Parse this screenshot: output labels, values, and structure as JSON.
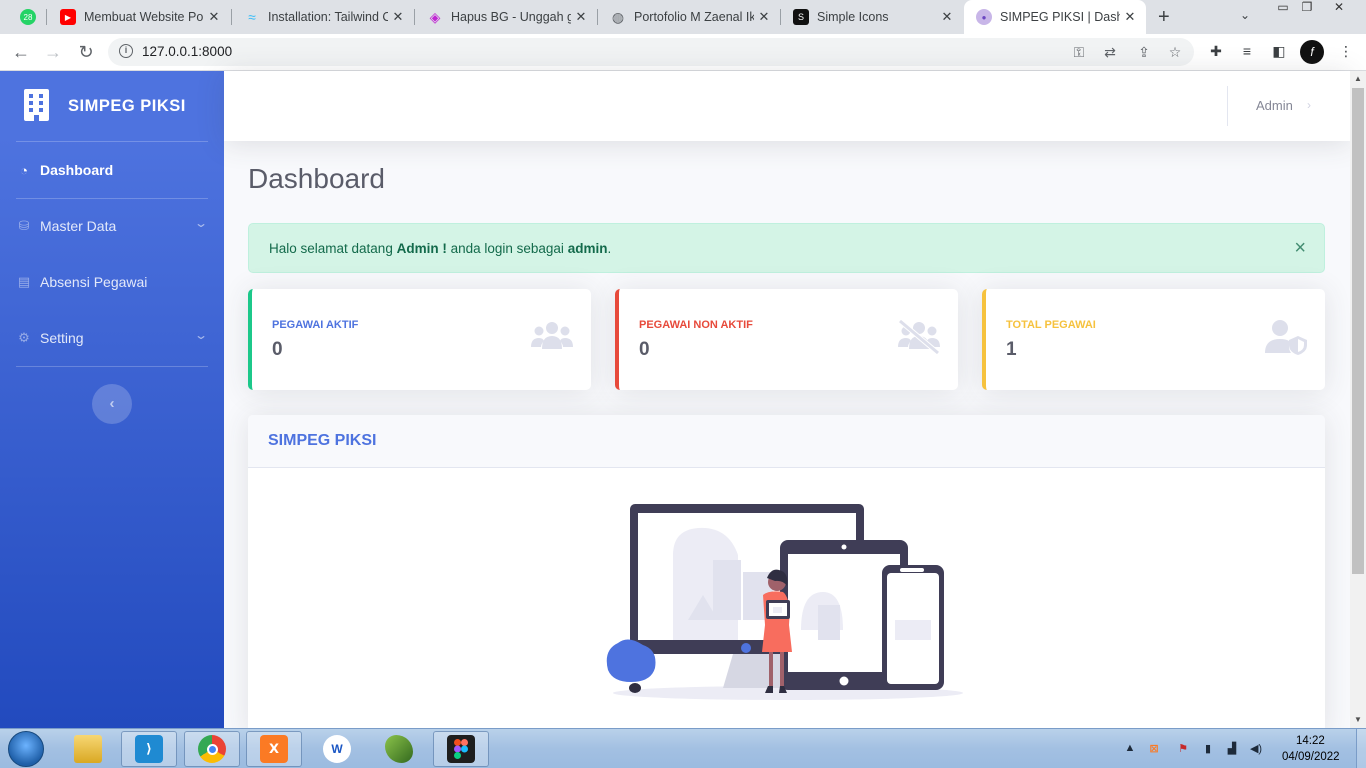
{
  "browser": {
    "tabs": [
      {
        "title": "",
        "icon": "whatsapp-icon",
        "badge": "28"
      },
      {
        "title": "Membuat Website Por",
        "icon": "youtube-icon"
      },
      {
        "title": "Installation: Tailwind C",
        "icon": "tailwind-icon"
      },
      {
        "title": "Hapus BG - Unggah g",
        "icon": "hapusbg-icon"
      },
      {
        "title": "Portofolio M Zaenal Ik",
        "icon": "globe-icon"
      },
      {
        "title": "Simple Icons",
        "icon": "simpleicons-icon"
      },
      {
        "title": "SIMPEG PIKSI | Dashbo",
        "icon": "simpeg-icon"
      }
    ],
    "url": "127.0.0.1:8000"
  },
  "sidebar": {
    "brand": "SIMPEG PIKSI",
    "items": [
      {
        "label": "Dashboard",
        "icon": "tachometer-icon",
        "active": true
      },
      {
        "label": "Master Data",
        "icon": "database-icon",
        "has_submenu": true
      },
      {
        "label": "Absensi Pegawai",
        "icon": "clipboard-icon"
      },
      {
        "label": "Setting",
        "icon": "gear-icon",
        "has_submenu": true
      }
    ]
  },
  "topbar": {
    "user_name": "Admin"
  },
  "page": {
    "title": "Dashboard",
    "alert": {
      "prefix": "Halo selamat datang ",
      "name": "Admin !",
      "middle": " anda login sebagai ",
      "role": "admin",
      "suffix": ".",
      "close": "×"
    },
    "stats": [
      {
        "label": "PEGAWAI AKTIF",
        "value": "0",
        "color": "#1cc88a",
        "label_color": "#4e73df",
        "icon": "users-icon"
      },
      {
        "label": "PEGAWAI NON AKTIF",
        "value": "0",
        "color": "#e74a3b",
        "label_color": "#e74a3b",
        "icon": "users-slash-icon"
      },
      {
        "label": "TOTAL PEGAWAI",
        "value": "1",
        "color": "#f6c23e",
        "label_color": "#f6c23e",
        "icon": "user-shield-icon"
      }
    ],
    "panel": {
      "title": "SIMPEG PIKSI"
    }
  },
  "taskbar": {
    "apps": [
      "windows-explorer",
      "vscode",
      "chrome",
      "xampp",
      "wps",
      "inkscape",
      "figma"
    ],
    "clock": {
      "time": "14:22",
      "date": "04/09/2022"
    }
  },
  "colors": {
    "primary": "#4e73df",
    "success": "#1cc88a",
    "danger": "#e74a3b",
    "warning": "#f6c23e"
  }
}
